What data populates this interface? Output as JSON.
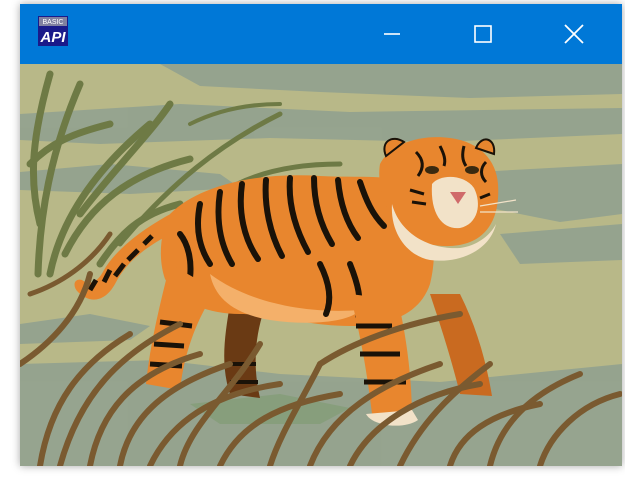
{
  "window": {
    "icon": "api-logo-icon",
    "icon_text_top": "BASIC",
    "icon_text_main": "API",
    "title": "",
    "controls": {
      "minimize_icon": "minimize-icon",
      "maximize_icon": "maximize-icon",
      "close_icon": "close-icon"
    }
  },
  "content": {
    "image_subject": "tiger-clipart"
  },
  "colors": {
    "titlebar": "#0078d7",
    "background": "#b8b888",
    "shadow_band": "#8fa090",
    "grass_dark": "#6e7a45",
    "grass_brown": "#7a5a30",
    "tiger_orange": "#e8862e",
    "tiger_light": "#f4b06a",
    "tiger_stripe": "#1a1208",
    "tiger_white": "#f2e2c8"
  }
}
